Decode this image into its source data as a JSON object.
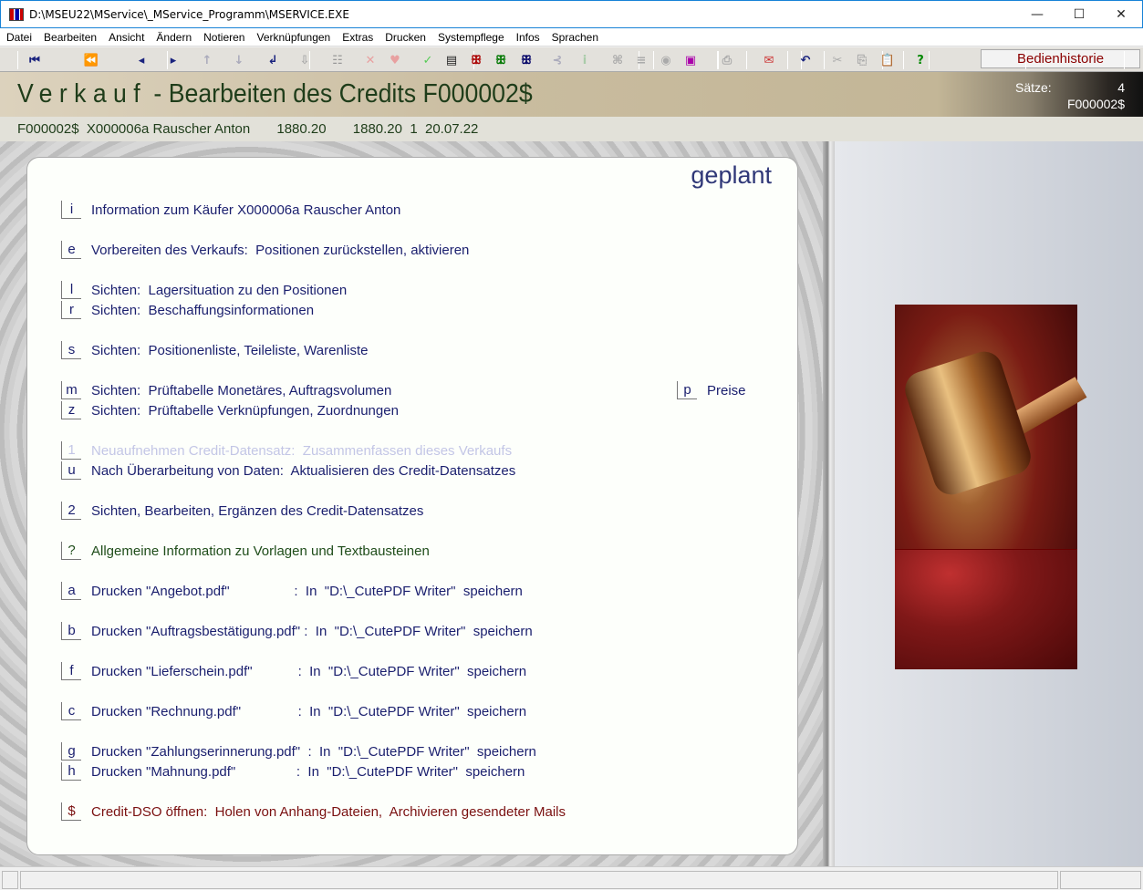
{
  "window": {
    "title": "D:\\MSEU22\\MService\\_MService_Programm\\MSERVICE.EXE",
    "minimize": "—",
    "maximize": "☐",
    "close": "✕"
  },
  "menu": [
    "Datei",
    "Bearbeiten",
    "Ansicht",
    "Ändern",
    "Notieren",
    "Verknüpfungen",
    "Extras",
    "Drucken",
    "Systempflege",
    "Infos",
    "Sprachen"
  ],
  "toolbar": {
    "history_button": "Bedienhistorie",
    "icons": [
      "first-record-icon",
      "previous-page-icon",
      "previous-record-icon",
      "next-record-icon",
      "up-arrow-icon",
      "down-arrow-icon",
      "enter-icon",
      "import-icon",
      "tree-icon",
      "delete-icon",
      "heart-icon",
      "check-icon",
      "document-icon",
      "red-squirrel-icon",
      "green-squirrel-icon",
      "blue-squirrel-icon",
      "branch-icon",
      "info-icon",
      "binoculars-icon",
      "list-icon",
      "eye-icon",
      "colorful-icon",
      "print-icon",
      "mail-icon",
      "undo-icon",
      "cut-icon",
      "copy-icon",
      "paste-icon",
      "help-icon"
    ]
  },
  "header": {
    "title_word": "Verkauf",
    "title_rest": "-  Bearbeiten des Credits F000002$",
    "saetze_label": "Sätze:",
    "saetze_value": "4",
    "record_id": "F000002$"
  },
  "infobar": "F000002$  X000006a Rauscher Anton       1880.20       1880.20  1  20.07.22",
  "panel": {
    "status": "geplant",
    "items": [
      {
        "key": "i",
        "label": "Information zum Käufer X000006a Rauscher Anton",
        "color": "#1a1f6e"
      },
      {
        "key": "e",
        "label": "Vorbereiten des Verkaufs:  Positionen zurückstellen, aktivieren",
        "color": "#1a1f6e"
      },
      {
        "key": "l",
        "label": "Sichten:  Lagersituation zu den Positionen",
        "color": "#1a1f6e"
      },
      {
        "key": "r",
        "label": "Sichten:  Beschaffungsinformationen",
        "color": "#1a1f6e"
      },
      {
        "key": "s",
        "label": "Sichten:  Positionenliste, Teileliste, Warenliste",
        "color": "#1a1f6e"
      },
      {
        "key": "m",
        "label": "Sichten:  Prüftabelle Monetäres, Auftragsvolumen",
        "color": "#1a1f6e"
      },
      {
        "key": "z",
        "label": "Sichten:  Prüftabelle Verknüpfungen, Zuordnungen",
        "color": "#1a1f6e"
      },
      {
        "key": "1",
        "label": "Neuaufnehmen Credit-Datensatz:  Zusammenfassen dieses Verkaufs",
        "color": "#c3c6e6"
      },
      {
        "key": "u",
        "label": "Nach Überarbeitung von Daten:  Aktualisieren des Credit-Datensatzes",
        "color": "#1a1f6e"
      },
      {
        "key": "2",
        "label": "Sichten, Bearbeiten, Ergänzen des Credit-Datensatzes",
        "color": "#1a1f6e"
      },
      {
        "key": "?",
        "label": "Allgemeine Information zu Vorlagen und Textbausteinen",
        "color": "#1f4d1a"
      },
      {
        "key": "a",
        "label": "Drucken \"Angebot.pdf\"                 :  In  \"D:\\_CutePDF Writer\"  speichern",
        "color": "#1a1f6e"
      },
      {
        "key": "b",
        "label": "Drucken \"Auftragsbestätigung.pdf\" :  In  \"D:\\_CutePDF Writer\"  speichern",
        "color": "#1a1f6e"
      },
      {
        "key": "f",
        "label": "Drucken \"Lieferschein.pdf\"            :  In  \"D:\\_CutePDF Writer\"  speichern",
        "color": "#1a1f6e"
      },
      {
        "key": "c",
        "label": "Drucken \"Rechnung.pdf\"               :  In  \"D:\\_CutePDF Writer\"  speichern",
        "color": "#1a1f6e"
      },
      {
        "key": "g",
        "label": "Drucken \"Zahlungserinnerung.pdf\"  :  In  \"D:\\_CutePDF Writer\"  speichern",
        "color": "#1a1f6e"
      },
      {
        "key": "h",
        "label": "Drucken \"Mahnung.pdf\"                :  In  \"D:\\_CutePDF Writer\"  speichern",
        "color": "#1a1f6e"
      },
      {
        "key": "$",
        "label": "Credit-DSO öffnen:  Holen von Anhang-Dateien,  Archivieren gesendeter Mails",
        "color": "#7a1010"
      }
    ],
    "side_item": {
      "key": "p",
      "label": "Preise",
      "color": "#1a1f6e"
    }
  }
}
